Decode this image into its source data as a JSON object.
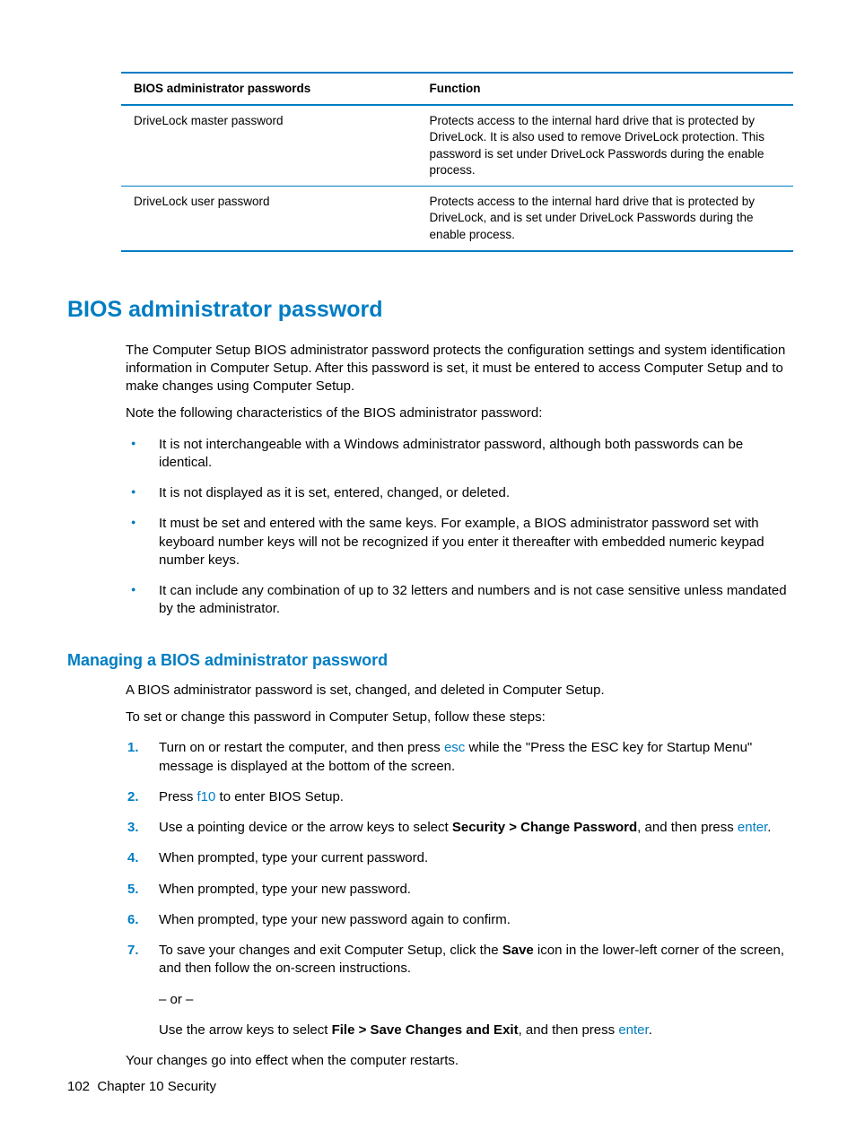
{
  "table": {
    "headers": [
      "BIOS administrator passwords",
      "Function"
    ],
    "rows": [
      {
        "name": "DriveLock master password",
        "func": "Protects access to the internal hard drive that is protected by DriveLock. It is also used to remove DriveLock protection. This password is set under DriveLock Passwords during the enable process."
      },
      {
        "name": "DriveLock user password",
        "func": "Protects access to the internal hard drive that is protected by DriveLock, and is set under DriveLock Passwords during the enable process."
      }
    ]
  },
  "h1": "BIOS administrator password",
  "intro1": "The Computer Setup BIOS administrator password protects the configuration settings and system identification information in Computer Setup. After this password is set, it must be entered to access Computer Setup and to make changes using Computer Setup.",
  "intro2": "Note the following characteristics of the BIOS administrator password:",
  "bullets": [
    "It is not interchangeable with a Windows administrator password, although both passwords can be identical.",
    "It is not displayed as it is set, entered, changed, or deleted.",
    "It must be set and entered with the same keys. For example, a BIOS administrator password set with keyboard number keys will not be recognized if you enter it thereafter with embedded numeric keypad number keys.",
    "It can include any combination of up to 32 letters and numbers and is not case sensitive unless mandated by the administrator."
  ],
  "h2": "Managing a BIOS administrator password",
  "h2_p1": "A BIOS administrator password is set, changed, and deleted in Computer Setup.",
  "h2_p2": "To set or change this password in Computer Setup, follow these steps:",
  "steps": {
    "s1a": "Turn on or restart the computer, and then press ",
    "s1_key": "esc",
    "s1b": " while the \"Press the ESC key for Startup Menu\" message is displayed at the bottom of the screen.",
    "s2a": "Press ",
    "s2_key": "f10",
    "s2b": " to enter BIOS Setup.",
    "s3a": "Use a pointing device or the arrow keys to select ",
    "s3_bold": "Security > Change Password",
    "s3b": ", and then press ",
    "s3_key": "enter",
    "s3c": ".",
    "s4": "When prompted, type your current password.",
    "s5": "When prompted, type your new password.",
    "s6": "When prompted, type your new password again to confirm.",
    "s7a": "To save your changes and exit Computer Setup, click the ",
    "s7_bold1": "Save",
    "s7b": " icon in the lower-left corner of the screen, and then follow the on-screen instructions.",
    "s7_or": "– or –",
    "s7c": "Use the arrow keys to select ",
    "s7_bold2": "File > Save Changes and Exit",
    "s7d": ", and then press ",
    "s7_key": "enter",
    "s7e": "."
  },
  "closing": "Your changes go into effect when the computer restarts.",
  "footer": {
    "page": "102",
    "chapter": "Chapter 10   Security"
  }
}
